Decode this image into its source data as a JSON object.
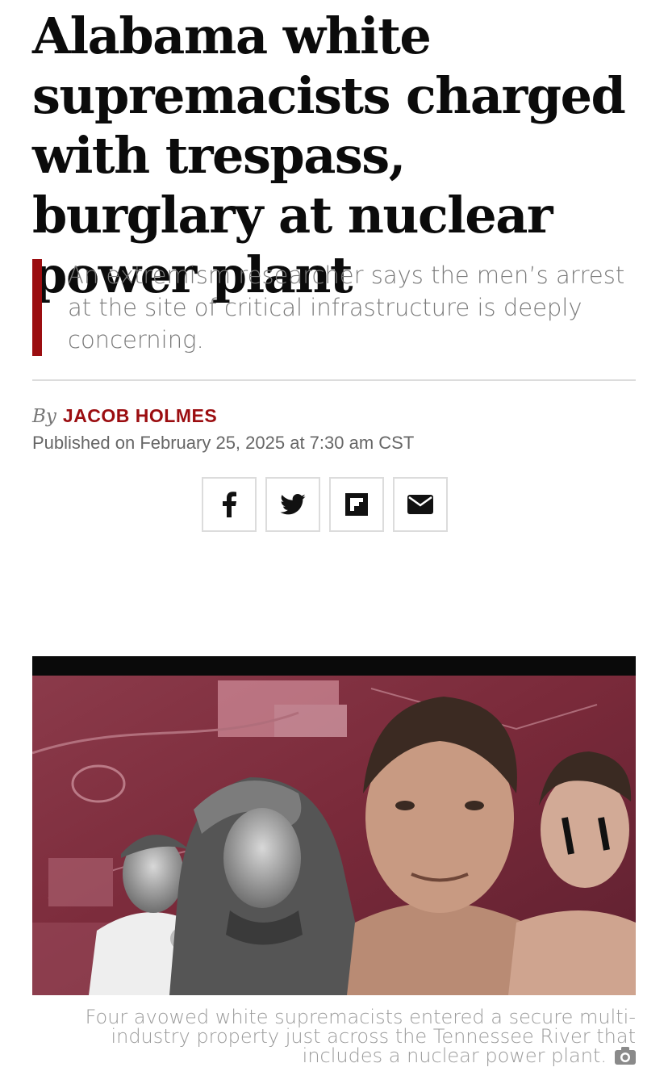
{
  "article": {
    "headline": "Alabama white supremacists charged with trespass, burglary at nuclear power plant",
    "dek": "An extremism researcher says the men’s arrest at the site of critical infrastructure is deeply concerning.",
    "byline_prefix": "By",
    "author": "JACOB HOLMES",
    "published": "Published on February 25, 2025 at 7:30 am CST"
  },
  "share": {
    "buttons": [
      {
        "icon": "facebook-icon"
      },
      {
        "icon": "twitter-icon"
      },
      {
        "icon": "flipboard-icon"
      },
      {
        "icon": "email-icon"
      }
    ]
  },
  "media": {
    "caption": "Four avowed white supremacists entered a secure multi-industry property just across the Tennessee River that includes a nuclear power plant.",
    "caption_icon": "camera-icon"
  },
  "colors": {
    "accent": "#9b0d10",
    "text": "#0b0b0b",
    "muted": "#7a7a7a",
    "rule": "#dcdcdc",
    "photo_tint": "#7a2d3c"
  }
}
